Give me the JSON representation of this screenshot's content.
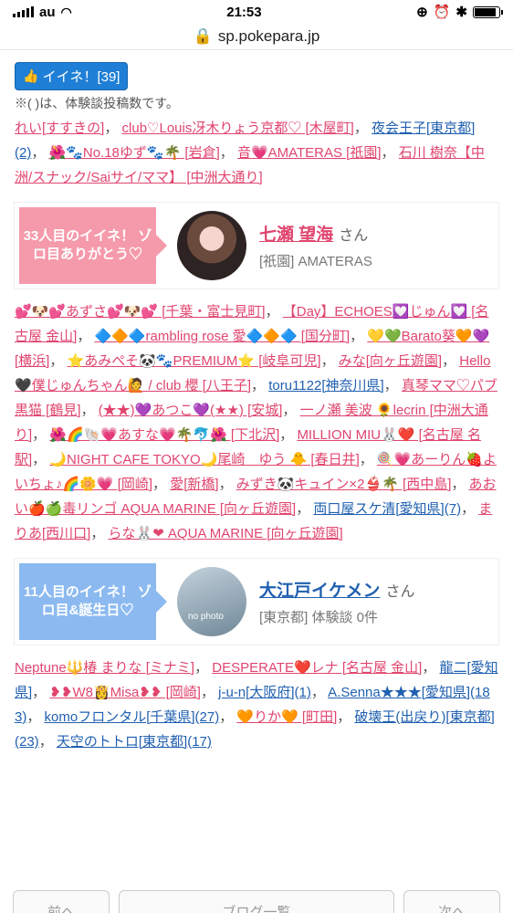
{
  "status": {
    "carrier": "au",
    "time": "21:53"
  },
  "browser": {
    "url": "sp.pokepara.jp"
  },
  "like": {
    "label": "イイネ！[39]"
  },
  "note": "※( )は、体験談投稿数です。",
  "group1": [
    {
      "text": "れい[すすきの]",
      "c": "pink"
    },
    {
      "text": "club♡Louis冴木りょう京都♡ [木屋町]",
      "c": "pink"
    },
    {
      "text": "夜会王子[東京都](2)",
      "c": "blue"
    },
    {
      "text": "🌺🐾No.18ゆず🐾🌴 [岩倉]",
      "c": "pink"
    },
    {
      "text": "音💗AMATERAS [祇園]",
      "c": "pink"
    },
    {
      "text": "石川 樹奈【中洲/スナック/Saiサイ/ママ】 [中洲大通り]",
      "c": "pink"
    }
  ],
  "card1": {
    "badge": "33人目のイイネ！ ゾロ目ありがとう♡",
    "name": "七瀬 望海",
    "san": "さん",
    "sub": "[祇園] AMATERAS"
  },
  "group2": [
    {
      "text": "💕🐶💕あずさ💕🐶💕 [千葉・富士見町]",
      "c": "pink"
    },
    {
      "text": "【Day】ECHOES💟じゅん💟 [名古屋 金山]",
      "c": "pink"
    },
    {
      "text": "🔷🔶🔷rambling rose 愛🔷🔶🔷 [国分町]",
      "c": "pink"
    },
    {
      "text": "💛💚Barato葵🧡💜 [横浜]",
      "c": "pink"
    },
    {
      "text": "⭐あみぺそ🐼🐾PREMIUM⭐ [岐阜可児]",
      "c": "pink"
    },
    {
      "text": "みな[向ヶ丘遊園]",
      "c": "pink"
    },
    {
      "text": "Hello🖤僕じゅんちゃん🙋 / club 櫻 [八王子]",
      "c": "pink"
    },
    {
      "text": "toru1122[神奈川県]",
      "c": "blue"
    },
    {
      "text": "真琴ママ♡パブ黒猫 [鶴見]",
      "c": "pink"
    },
    {
      "text": "(★★)💜あつこ💜(★★) [安城]",
      "c": "pink"
    },
    {
      "text": "一ノ瀬 美波 🌻lecrin [中洲大通り]",
      "c": "pink"
    },
    {
      "text": "🌺🌈🐚💗あすな💗🌴🐬🌺 [下北沢]",
      "c": "pink"
    },
    {
      "text": "MILLION MIU🐰❤️ [名古屋 名駅]",
      "c": "pink"
    },
    {
      "text": "🌙NIGHT CAFE TOKYO🌙尾崎　ゆう 🐥 [春日井]",
      "c": "pink"
    },
    {
      "text": "🍭💗あーりん🍓よいちょ♪🌈🌼💗 [岡崎]",
      "c": "pink"
    },
    {
      "text": "愛[新橋]",
      "c": "pink"
    },
    {
      "text": "みずき🐼キュイン×2👙🌴 [西中島]",
      "c": "pink"
    },
    {
      "text": "あおい🍎🍏毒リンゴ AQUA MARINE [向ヶ丘遊園]",
      "c": "pink"
    },
    {
      "text": "両口屋スケ清[愛知県](7)",
      "c": "blue"
    },
    {
      "text": "まりあ[西川口]",
      "c": "pink"
    },
    {
      "text": "らな🐰❤ AQUA MARINE [向ヶ丘遊園]",
      "c": "pink"
    }
  ],
  "card2": {
    "badge": "11人目のイイネ！ ゾロ目&誕生日♡",
    "name": "大江戸イケメン",
    "san": "さん",
    "sub": "[東京都] 体験談 0件",
    "avatar_text": "no photo"
  },
  "group3": [
    {
      "text": "Neptune🔱椿 まりな [ミナミ]",
      "c": "pink"
    },
    {
      "text": "DESPERATE❤️レナ [名古屋 金山]",
      "c": "pink"
    },
    {
      "text": "龍二[愛知県]",
      "c": "blue"
    },
    {
      "text": "❥❥W8👸Misa❥❥ [岡崎]",
      "c": "pink"
    },
    {
      "text": "j-u-n[大阪府](1)",
      "c": "blue"
    },
    {
      "text": "A.Senna★★★[愛知県](183)",
      "c": "blue"
    },
    {
      "text": "komoフロンタル[千葉県](27)",
      "c": "blue"
    },
    {
      "text": "🧡りか🧡 [町田]",
      "c": "pink"
    },
    {
      "text": "破壊王(出戻り)[東京都](23)",
      "c": "blue"
    },
    {
      "text": "天空のトトロ[東京都](17)",
      "c": "blue"
    }
  ],
  "pager": {
    "prev": "前へ",
    "blog": "ブログ一覧",
    "next": "次へ"
  }
}
